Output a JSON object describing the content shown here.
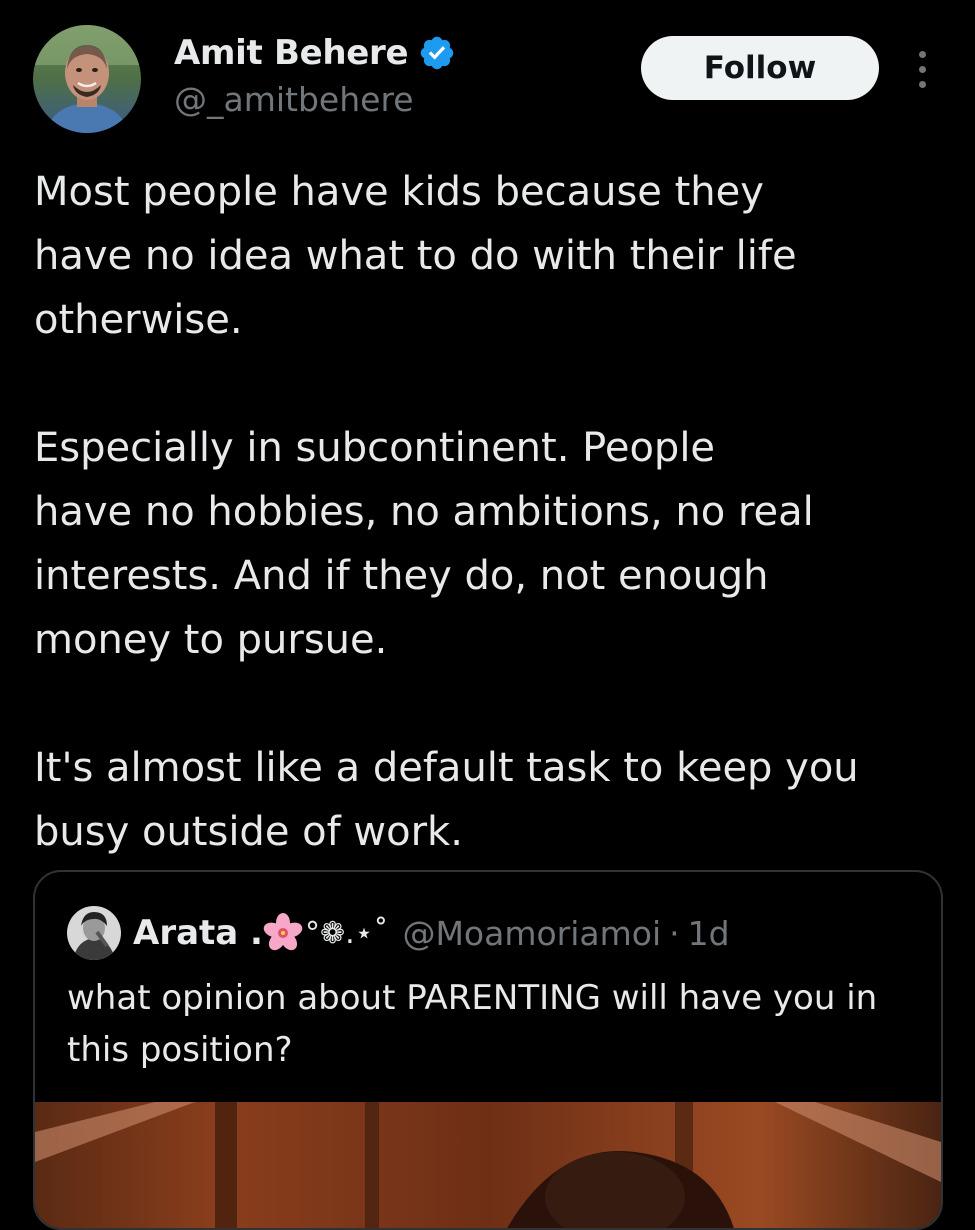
{
  "author": {
    "name": "Amit Behere",
    "handle": "@_amitbehere",
    "verified": true,
    "verified_color": "#1d9bf0"
  },
  "actions": {
    "follow_label": "Follow",
    "more_icon": "more-vertical-icon"
  },
  "tweet": {
    "paragraphs": [
      "Most people have kids because they\nhave no idea what to do with their life\notherwise.",
      "Especially in subcontinent. People\nhave no hobbies, no ambitions, no real\ninterests. And if they do, not enough\nmoney to pursue.",
      "It's almost like a default task to keep you\nbusy outside of work."
    ]
  },
  "quote": {
    "name": "Arata .",
    "name_decoration": "°❁.⋆˚",
    "name_emoji": "cherry-blossom-icon",
    "handle": "@Moamoriamoi",
    "separator": "·",
    "time": "1d",
    "text": "what opinion about PARENTING will have you in this position?"
  },
  "theme": {
    "background": "#000000",
    "text_primary": "#e7e9ea",
    "text_secondary": "#71767b",
    "border": "#2f3336",
    "button_bg": "#eff3f4",
    "button_text": "#0f1419"
  }
}
